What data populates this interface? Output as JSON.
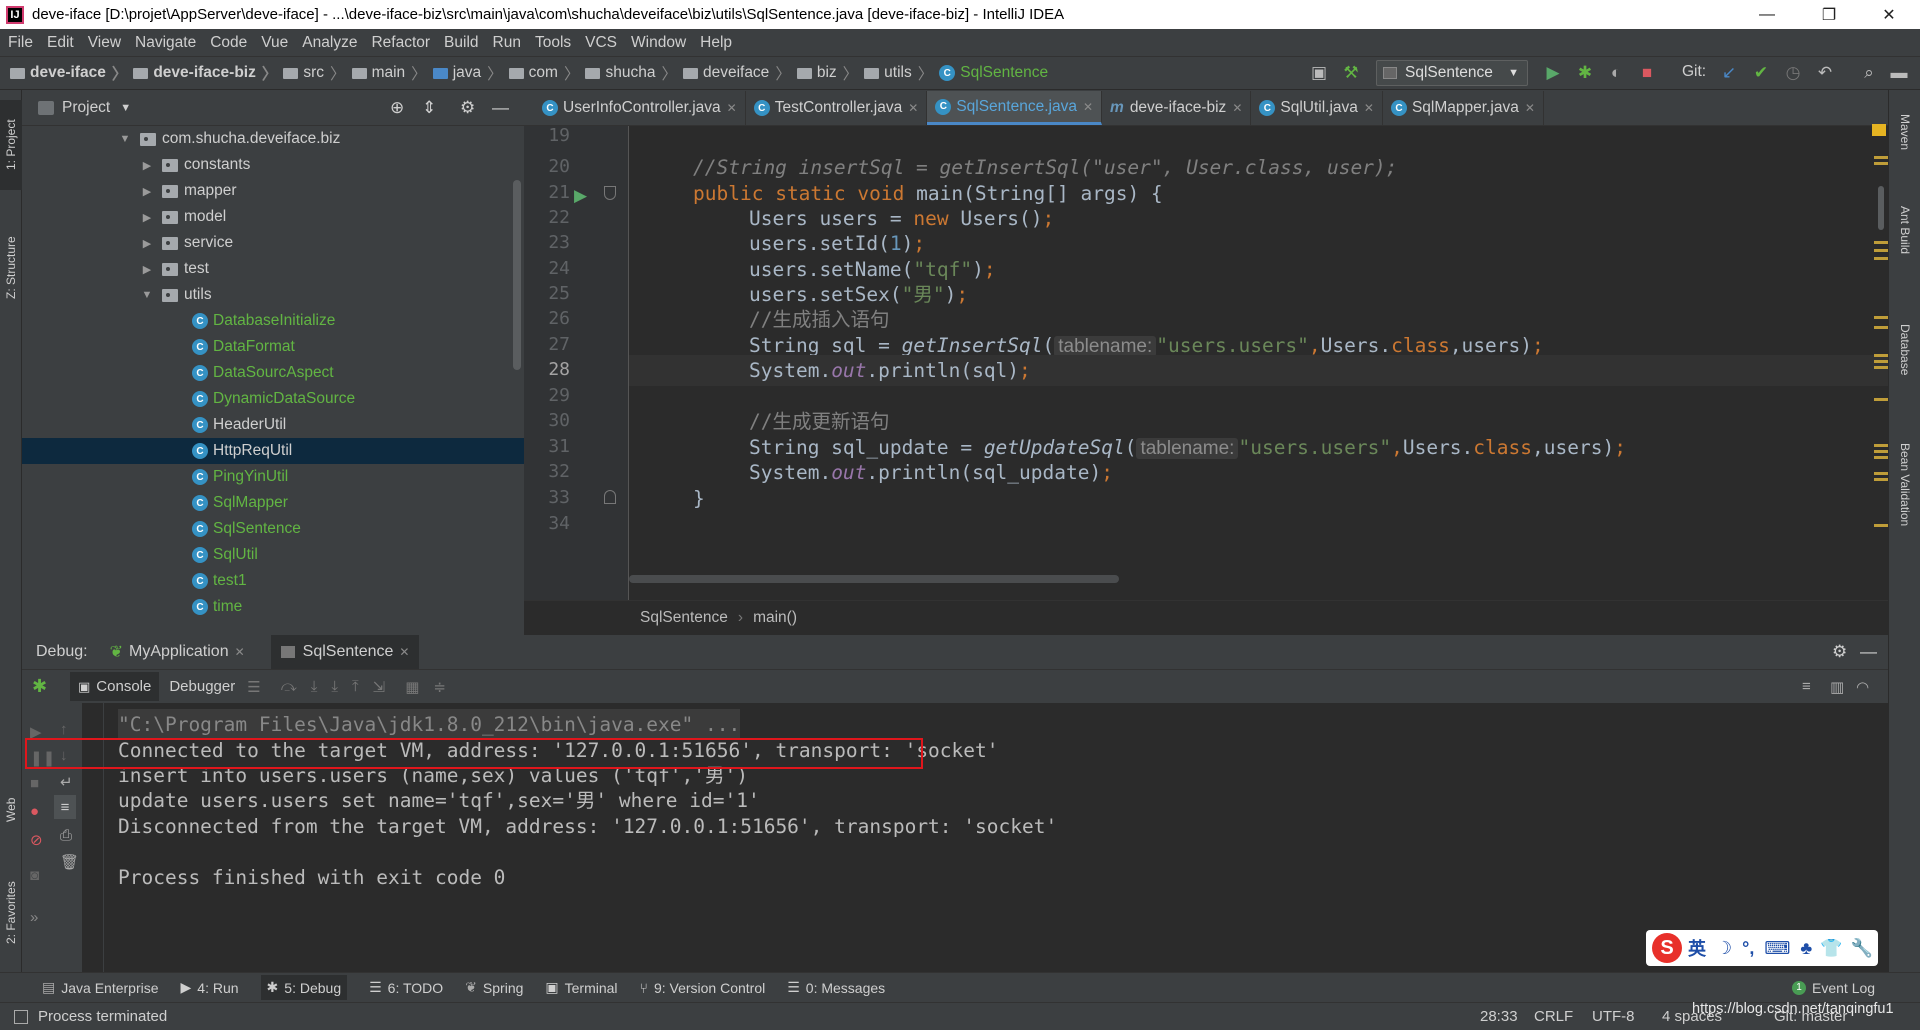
{
  "window": {
    "title": "deve-iface [D:\\projet\\AppServer\\deve-iface] - ...\\deve-iface-biz\\src\\main\\java\\com\\shucha\\deveiface\\biz\\utils\\SqlSentence.java [deve-iface-biz] - IntelliJ IDEA",
    "min": "—",
    "max": "❐",
    "close": "✕"
  },
  "menu": [
    "File",
    "Edit",
    "View",
    "Navigate",
    "Code",
    "Vue",
    "Analyze",
    "Refactor",
    "Build",
    "Run",
    "Tools",
    "VCS",
    "Window",
    "Help"
  ],
  "breadcrumbs": [
    "deve-iface",
    "deve-iface-biz",
    "src",
    "main",
    "java",
    "com",
    "shucha",
    "deveiface",
    "biz",
    "utils",
    "SqlSentence"
  ],
  "toolbar": {
    "run_config": "SqlSentence",
    "git_label": "Git:"
  },
  "left_tabs": {
    "project": "1: Project",
    "structure": "Z: Structure",
    "web": "Web",
    "favorites": "2: Favorites"
  },
  "right_tabs": [
    "Maven",
    "Ant Build",
    "Database",
    "Bean Validation"
  ],
  "project": {
    "header": "Project",
    "tree": [
      {
        "label": "com.shucha.deveiface.biz",
        "kind": "pkg",
        "open": true,
        "level": 0
      },
      {
        "label": "constants",
        "kind": "pkg",
        "open": false,
        "level": 1
      },
      {
        "label": "mapper",
        "kind": "pkg",
        "open": false,
        "level": 1
      },
      {
        "label": "model",
        "kind": "pkg",
        "open": false,
        "level": 1
      },
      {
        "label": "service",
        "kind": "pkg",
        "open": false,
        "level": 1
      },
      {
        "label": "test",
        "kind": "pkg",
        "open": false,
        "level": 1
      },
      {
        "label": "utils",
        "kind": "pkg",
        "open": true,
        "level": 1
      },
      {
        "label": "DatabaseInitialize",
        "kind": "cls",
        "level": 2,
        "color": "green"
      },
      {
        "label": "DataFormat",
        "kind": "cls",
        "level": 2,
        "color": "green"
      },
      {
        "label": "DataSourcAspect",
        "kind": "cls",
        "level": 2,
        "color": "green"
      },
      {
        "label": "DynamicDataSource",
        "kind": "cls",
        "level": 2,
        "color": "green"
      },
      {
        "label": "HeaderUtil",
        "kind": "cls",
        "level": 2,
        "color": "normal"
      },
      {
        "label": "HttpReqUtil",
        "kind": "cls",
        "level": 2,
        "color": "normal",
        "selected": true
      },
      {
        "label": "PingYinUtil",
        "kind": "cls",
        "level": 2,
        "color": "green"
      },
      {
        "label": "SqlMapper",
        "kind": "cls",
        "level": 2,
        "color": "green"
      },
      {
        "label": "SqlSentence",
        "kind": "cls",
        "level": 2,
        "color": "green"
      },
      {
        "label": "SqlUtil",
        "kind": "cls",
        "level": 2,
        "color": "green"
      },
      {
        "label": "test1",
        "kind": "cls",
        "level": 2,
        "color": "green"
      },
      {
        "label": "time",
        "kind": "cls",
        "level": 2,
        "color": "green"
      }
    ]
  },
  "editor": {
    "tabs": [
      {
        "label": "UserInfoController.java",
        "icon": "C"
      },
      {
        "label": "TestController.java",
        "icon": "C"
      },
      {
        "label": "SqlSentence.java",
        "icon": "C",
        "active": true
      },
      {
        "label": "deve-iface-biz",
        "icon": "m"
      },
      {
        "label": "SqlUtil.java",
        "icon": "C"
      },
      {
        "label": "SqlMapper.java",
        "icon": "C"
      }
    ],
    "line_numbers": [
      "19",
      "20",
      "21",
      "22",
      "23",
      "24",
      "25",
      "26",
      "27",
      "28",
      "29",
      "30",
      "31",
      "32",
      "33",
      "34"
    ],
    "current_line": "28",
    "code": {
      "l20": "//String insertSql = getInsertSql(\"user\", User.class, user);",
      "kw_public": "public",
      "kw_static": "static",
      "kw_void": "void",
      "main_sig": "main(String[] args) {",
      "users_decl": "Users users = ",
      "kw_new": "new",
      "users_ctor": " Users()",
      "set_id": "users.setId(",
      "n1": "1",
      "set_name": "users.setName(",
      "s_tqf": "\"tqf\"",
      "set_sex": "users.setSex(",
      "s_nan": "\"男\"",
      "close_paren": ")",
      "semi": ";",
      "c_insert": "//生成插入语句",
      "string_sql": "String sql = ",
      "get_insert": "getInsertSql",
      "hint": "tablename:",
      "s_users_users": "\"users.users\"",
      "comma": ",",
      "users_cls": "Users.",
      "kw_class": "class",
      "users_arg": ",users)",
      "system": "System.",
      "out": "out",
      "println_sql": ".println(sql)",
      "c_update": "//生成更新语句",
      "string_sql_update": "String sql_update = ",
      "get_update": "getUpdateSql",
      "println_sql_update": ".println(sql_update)",
      "open_paren": "(",
      "brace_close": "}"
    },
    "breadcrumb": [
      "SqlSentence",
      "main()"
    ]
  },
  "debug": {
    "label": "Debug:",
    "sessions": [
      "MyApplication",
      "SqlSentence"
    ],
    "tabs": [
      "Console",
      "Debugger"
    ],
    "console": [
      "\"C:\\Program Files\\Java\\jdk1.8.0_212\\bin\\java.exe\" ...",
      "Connected to the target VM, address: '127.0.0.1:51656', transport: 'socket'",
      "insert into users.users (name,sex) values ('tqf','男')",
      "update users.users set name='tqf',sex='男' where id='1'",
      "Disconnected from the target VM, address: '127.0.0.1:51656', transport: 'socket'",
      "",
      "Process finished with exit code 0"
    ]
  },
  "bottom_tabs": [
    "Java Enterprise",
    "4: Run",
    "5: Debug",
    "6: TODO",
    "Spring",
    "Terminal",
    "9: Version Control",
    "0: Messages"
  ],
  "event_log": "Event Log",
  "status": {
    "left": "Process terminated",
    "position": "28:33",
    "line_sep": "CRLF",
    "encoding": "UTF-8",
    "indent": "4 spaces",
    "git": "Git: master",
    "watermark": "https://blog.csdn.net/tanqingfu1"
  },
  "ime": {
    "lang": "英"
  },
  "colors": {
    "accent": "#4a88c7",
    "highlight_box": "#e0161c",
    "keyword": "#cc7832",
    "string": "#6a8759",
    "number": "#6897bb"
  }
}
